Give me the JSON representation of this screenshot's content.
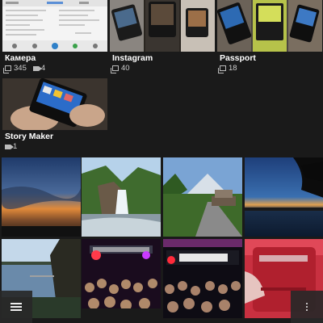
{
  "albums": [
    {
      "name": "Камера",
      "photos": "345",
      "videos": "4"
    },
    {
      "name": "Instagram",
      "photos": "40",
      "videos": ""
    },
    {
      "name": "Passport",
      "photos": "18",
      "videos": ""
    },
    {
      "name": "Story Maker",
      "photos": "",
      "videos": "1"
    }
  ],
  "grid": [
    {
      "name": "sunset-sky-photo"
    },
    {
      "name": "waterfall-photo"
    },
    {
      "name": "mountain-road-photo"
    },
    {
      "name": "lake-dusk-photo"
    },
    {
      "name": "lake-shore-photo"
    },
    {
      "name": "concert-crowd-photo"
    },
    {
      "name": "blackberry-stage-photo"
    },
    {
      "name": "red-bag-photo"
    }
  ],
  "icons": {
    "menu": "menu-icon",
    "overflow": "overflow-icon",
    "photo_count": "photo-count-icon",
    "video_count": "video-count-icon"
  }
}
